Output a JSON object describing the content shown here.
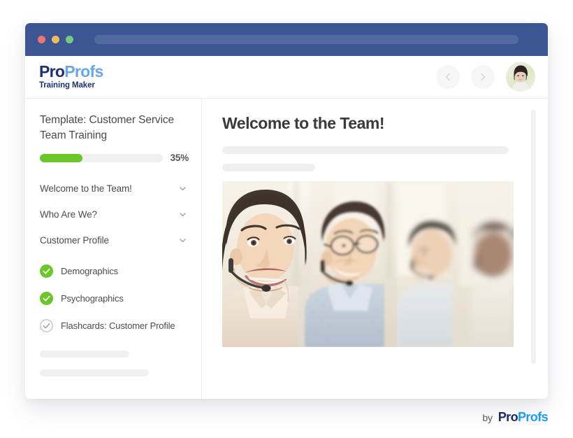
{
  "window": {
    "traffic_lights": [
      "close",
      "minimize",
      "maximize"
    ],
    "address_placeholder": ""
  },
  "header": {
    "logo": {
      "pro": "Pro",
      "profs": "Profs",
      "tagline": "Training Maker"
    },
    "prev_label": "Previous",
    "next_label": "Next",
    "avatar_alt": "User avatar"
  },
  "sidebar": {
    "course_title": "Template: Customer Service Team Training",
    "progress": {
      "percent": 35,
      "percent_label": "35%",
      "bar_color": "#6cc62a"
    },
    "sections": [
      {
        "label": "Welcome to the Team!",
        "expanded": false
      },
      {
        "label": "Who Are We?",
        "expanded": false
      },
      {
        "label": "Customer Profile",
        "expanded": true
      }
    ],
    "lessons": [
      {
        "label": "Demographics",
        "completed": true
      },
      {
        "label": "Psychographics",
        "completed": true
      },
      {
        "label": "Flashcards: Customer Profile",
        "completed": false
      }
    ],
    "placeholder_bars": [
      128,
      156
    ]
  },
  "content": {
    "title": "Welcome to the Team!",
    "placeholder_bars": [
      410,
      133
    ],
    "hero_image_alt": "Customer service team with headsets smiling in an office"
  },
  "footer": {
    "by": "by",
    "logo_pro": "Pro",
    "logo_profs": "Profs"
  }
}
